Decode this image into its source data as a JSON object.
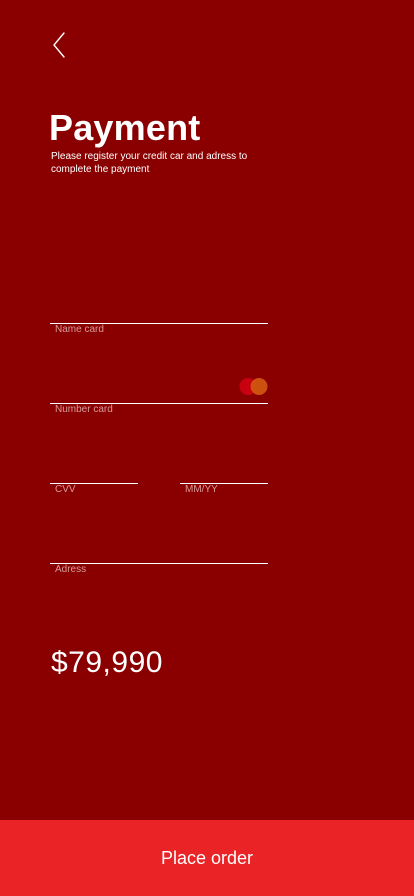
{
  "header": {
    "back_icon": "chevron-left-icon",
    "title": "Payment",
    "subtitle": "Please register your credit car and adress to complete the payment"
  },
  "form": {
    "name_card_label": "Name card",
    "number_card_label": "Number card",
    "card_brand_icon": "mastercard-icon",
    "cvv_label": "CVV",
    "expiry_label": "MM/YY",
    "address_label": "Adress"
  },
  "summary": {
    "price": "$79,990"
  },
  "footer": {
    "place_order_label": "Place order"
  },
  "colors": {
    "background": "#8a0000",
    "button": "#ea2326",
    "text": "#ffffff",
    "label": "#d89a9a",
    "mastercard_red": "#c8000f",
    "mastercard_orange": "#d45a10"
  }
}
